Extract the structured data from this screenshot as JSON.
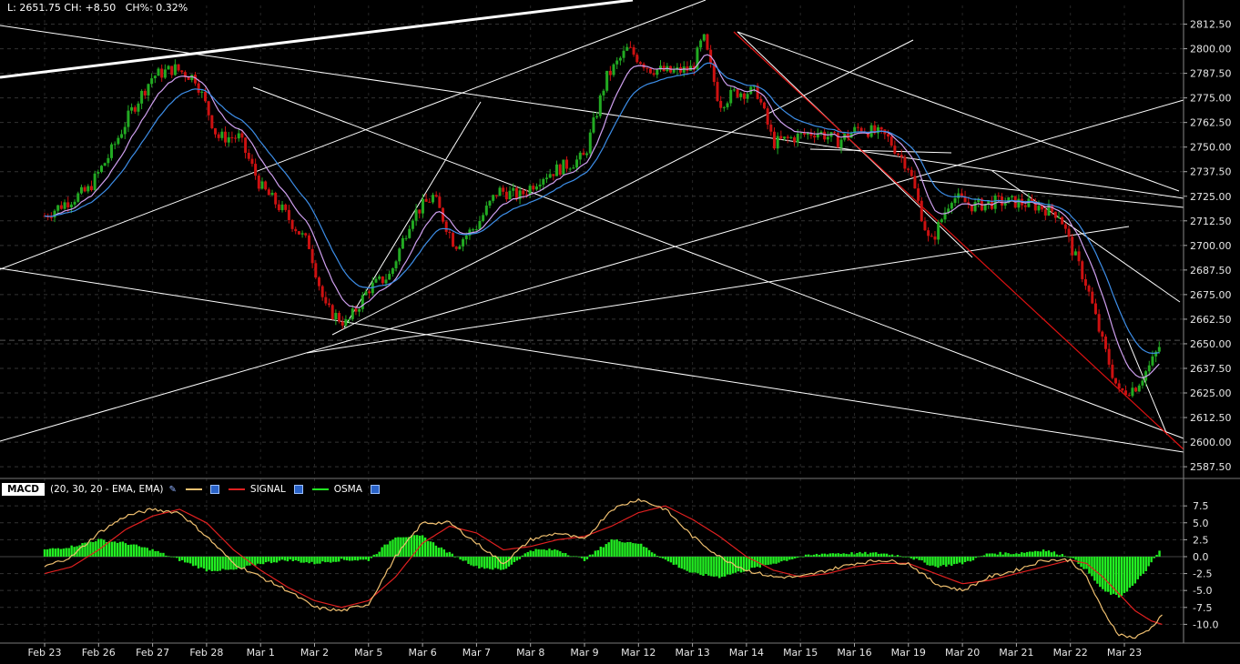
{
  "header": {
    "last": "L: 2651.75",
    "change": "CH: +8.50",
    "change_pct": "CH%: 0.32%"
  },
  "macd_header": {
    "tag": "MACD",
    "params": "(20, 30, 20 - EMA, EMA)",
    "signal_label": "SIGNAL",
    "osma_label": "OSMA"
  },
  "colors": {
    "background": "#000000",
    "up_candle": "#22aa22",
    "down_candle": "#cc1111",
    "ema_fast": "#d0a0f0",
    "ema_slow": "#3d8ee8",
    "trendline": "#ffffff",
    "red_trendline": "#dd1111",
    "macd_line": "#f0c070",
    "signal_line": "#e02020",
    "osma": "#22ee22"
  },
  "chart_data": [
    {
      "type": "candlestick",
      "title": "",
      "x_categories": [
        "Feb 23",
        "Feb 26",
        "Feb 27",
        "Feb 28",
        "Mar 1",
        "Mar 2",
        "Mar 5",
        "Mar 6",
        "Mar 7",
        "Mar 8",
        "Mar 9",
        "Mar 12",
        "Mar 13",
        "Mar 14",
        "Mar 15",
        "Mar 16",
        "Mar 19",
        "Mar 20",
        "Mar 21",
        "Mar 22",
        "Mar 23"
      ],
      "y_ticks": [
        2812.5,
        2800.0,
        2787.5,
        2775.0,
        2762.5,
        2750.0,
        2737.5,
        2725.0,
        2712.5,
        2700.0,
        2687.5,
        2675.0,
        2662.5,
        2650.0,
        2637.5,
        2625.0,
        2612.5,
        2600.0,
        2587.5
      ],
      "ylim": [
        2582,
        2822
      ],
      "last_price": 2651.75,
      "close_path": [
        {
          "x": 0,
          "y": 2715
        },
        {
          "x": 0.4,
          "y": 2722
        },
        {
          "x": 0.8,
          "y": 2728
        },
        {
          "x": 1.2,
          "y": 2746
        },
        {
          "x": 1.6,
          "y": 2768
        },
        {
          "x": 2.0,
          "y": 2786
        },
        {
          "x": 2.4,
          "y": 2790
        },
        {
          "x": 2.8,
          "y": 2785
        },
        {
          "x": 3.2,
          "y": 2755
        },
        {
          "x": 3.6,
          "y": 2755
        },
        {
          "x": 4.0,
          "y": 2730
        },
        {
          "x": 4.4,
          "y": 2718
        },
        {
          "x": 4.9,
          "y": 2700
        },
        {
          "x": 5.2,
          "y": 2668
        },
        {
          "x": 5.6,
          "y": 2660
        },
        {
          "x": 6.0,
          "y": 2678
        },
        {
          "x": 6.4,
          "y": 2685
        },
        {
          "x": 6.8,
          "y": 2715
        },
        {
          "x": 7.2,
          "y": 2725
        },
        {
          "x": 7.6,
          "y": 2700
        },
        {
          "x": 8.0,
          "y": 2710
        },
        {
          "x": 8.4,
          "y": 2728
        },
        {
          "x": 8.8,
          "y": 2725
        },
        {
          "x": 9.2,
          "y": 2735
        },
        {
          "x": 9.6,
          "y": 2740
        },
        {
          "x": 10.0,
          "y": 2745
        },
        {
          "x": 10.4,
          "y": 2785
        },
        {
          "x": 10.8,
          "y": 2800
        },
        {
          "x": 11.2,
          "y": 2790
        },
        {
          "x": 11.6,
          "y": 2788
        },
        {
          "x": 12.0,
          "y": 2790
        },
        {
          "x": 12.2,
          "y": 2806
        },
        {
          "x": 12.5,
          "y": 2772
        },
        {
          "x": 12.8,
          "y": 2778
        },
        {
          "x": 13.2,
          "y": 2778
        },
        {
          "x": 13.5,
          "y": 2752
        },
        {
          "x": 13.9,
          "y": 2755
        },
        {
          "x": 14.3,
          "y": 2758
        },
        {
          "x": 14.7,
          "y": 2753
        },
        {
          "x": 15.1,
          "y": 2760
        },
        {
          "x": 15.6,
          "y": 2755
        },
        {
          "x": 16.0,
          "y": 2740
        },
        {
          "x": 16.4,
          "y": 2700
        },
        {
          "x": 16.8,
          "y": 2725
        },
        {
          "x": 17.2,
          "y": 2720
        },
        {
          "x": 17.6,
          "y": 2722
        },
        {
          "x": 18.0,
          "y": 2722
        },
        {
          "x": 18.4,
          "y": 2720
        },
        {
          "x": 18.8,
          "y": 2716
        },
        {
          "x": 19.0,
          "y": 2700
        },
        {
          "x": 19.3,
          "y": 2680
        },
        {
          "x": 19.6,
          "y": 2650
        },
        {
          "x": 19.9,
          "y": 2625
        },
        {
          "x": 20.2,
          "y": 2628
        },
        {
          "x": 20.5,
          "y": 2640
        },
        {
          "x": 20.7,
          "y": 2651.75
        }
      ]
    },
    {
      "type": "macd",
      "title": "",
      "y_ticks": [
        7.5,
        5.0,
        2.5,
        0.0,
        -2.5,
        -5.0,
        -7.5,
        -10.0
      ],
      "ylim": [
        -12.5,
        9
      ],
      "macd": [
        {
          "x": 0,
          "y": -1.5
        },
        {
          "x": 0.5,
          "y": 0
        },
        {
          "x": 1.0,
          "y": 3.5
        },
        {
          "x": 1.5,
          "y": 6
        },
        {
          "x": 2.0,
          "y": 7
        },
        {
          "x": 2.5,
          "y": 6.5
        },
        {
          "x": 3.0,
          "y": 3
        },
        {
          "x": 3.5,
          "y": -1
        },
        {
          "x": 4.0,
          "y": -3
        },
        {
          "x": 4.5,
          "y": -5
        },
        {
          "x": 5.0,
          "y": -7.5
        },
        {
          "x": 5.5,
          "y": -8
        },
        {
          "x": 6.0,
          "y": -7
        },
        {
          "x": 6.5,
          "y": 0
        },
        {
          "x": 7.0,
          "y": 5
        },
        {
          "x": 7.5,
          "y": 5
        },
        {
          "x": 8.0,
          "y": 2
        },
        {
          "x": 8.5,
          "y": -1
        },
        {
          "x": 9.0,
          "y": 2.5
        },
        {
          "x": 9.5,
          "y": 3.5
        },
        {
          "x": 10.0,
          "y": 2.5
        },
        {
          "x": 10.5,
          "y": 7
        },
        {
          "x": 11.0,
          "y": 8.5
        },
        {
          "x": 11.5,
          "y": 7
        },
        {
          "x": 12.0,
          "y": 3
        },
        {
          "x": 12.5,
          "y": 0
        },
        {
          "x": 13.0,
          "y": -2
        },
        {
          "x": 13.5,
          "y": -3
        },
        {
          "x": 14.0,
          "y": -3
        },
        {
          "x": 14.5,
          "y": -2
        },
        {
          "x": 15.0,
          "y": -1
        },
        {
          "x": 15.5,
          "y": -0.5
        },
        {
          "x": 16.0,
          "y": -1
        },
        {
          "x": 16.5,
          "y": -4
        },
        {
          "x": 17.0,
          "y": -5
        },
        {
          "x": 17.5,
          "y": -3
        },
        {
          "x": 18.0,
          "y": -2
        },
        {
          "x": 18.5,
          "y": -0.5
        },
        {
          "x": 19.0,
          "y": -0.5
        },
        {
          "x": 19.3,
          "y": -3
        },
        {
          "x": 19.6,
          "y": -8
        },
        {
          "x": 19.9,
          "y": -11.5
        },
        {
          "x": 20.2,
          "y": -12
        },
        {
          "x": 20.5,
          "y": -10.5
        },
        {
          "x": 20.7,
          "y": -8.5
        }
      ],
      "signal": [
        {
          "x": 0,
          "y": -2.5
        },
        {
          "x": 0.5,
          "y": -1.5
        },
        {
          "x": 1.0,
          "y": 1
        },
        {
          "x": 1.5,
          "y": 4
        },
        {
          "x": 2.0,
          "y": 6
        },
        {
          "x": 2.5,
          "y": 7
        },
        {
          "x": 3.0,
          "y": 5
        },
        {
          "x": 3.5,
          "y": 1
        },
        {
          "x": 4.0,
          "y": -2
        },
        {
          "x": 4.5,
          "y": -4.5
        },
        {
          "x": 5.0,
          "y": -6.5
        },
        {
          "x": 5.5,
          "y": -7.5
        },
        {
          "x": 6.0,
          "y": -6.5
        },
        {
          "x": 6.5,
          "y": -3
        },
        {
          "x": 7.0,
          "y": 2
        },
        {
          "x": 7.5,
          "y": 4.5
        },
        {
          "x": 8.0,
          "y": 3.5
        },
        {
          "x": 8.5,
          "y": 1
        },
        {
          "x": 9.0,
          "y": 1.5
        },
        {
          "x": 9.5,
          "y": 2.5
        },
        {
          "x": 10.0,
          "y": 3
        },
        {
          "x": 10.5,
          "y": 4.5
        },
        {
          "x": 11.0,
          "y": 6.5
        },
        {
          "x": 11.5,
          "y": 7.5
        },
        {
          "x": 12.0,
          "y": 5.5
        },
        {
          "x": 12.5,
          "y": 3
        },
        {
          "x": 13.0,
          "y": 0
        },
        {
          "x": 13.5,
          "y": -2
        },
        {
          "x": 14.0,
          "y": -3
        },
        {
          "x": 14.5,
          "y": -2.5
        },
        {
          "x": 15.0,
          "y": -1.5
        },
        {
          "x": 15.5,
          "y": -1
        },
        {
          "x": 16.0,
          "y": -1
        },
        {
          "x": 16.5,
          "y": -2.5
        },
        {
          "x": 17.0,
          "y": -4
        },
        {
          "x": 17.5,
          "y": -3.5
        },
        {
          "x": 18.0,
          "y": -2.5
        },
        {
          "x": 18.5,
          "y": -1.5
        },
        {
          "x": 19.0,
          "y": -0.5
        },
        {
          "x": 19.3,
          "y": -1
        },
        {
          "x": 19.6,
          "y": -3
        },
        {
          "x": 19.9,
          "y": -5.5
        },
        {
          "x": 20.2,
          "y": -8
        },
        {
          "x": 20.5,
          "y": -9.5
        },
        {
          "x": 20.7,
          "y": -10
        }
      ]
    }
  ]
}
